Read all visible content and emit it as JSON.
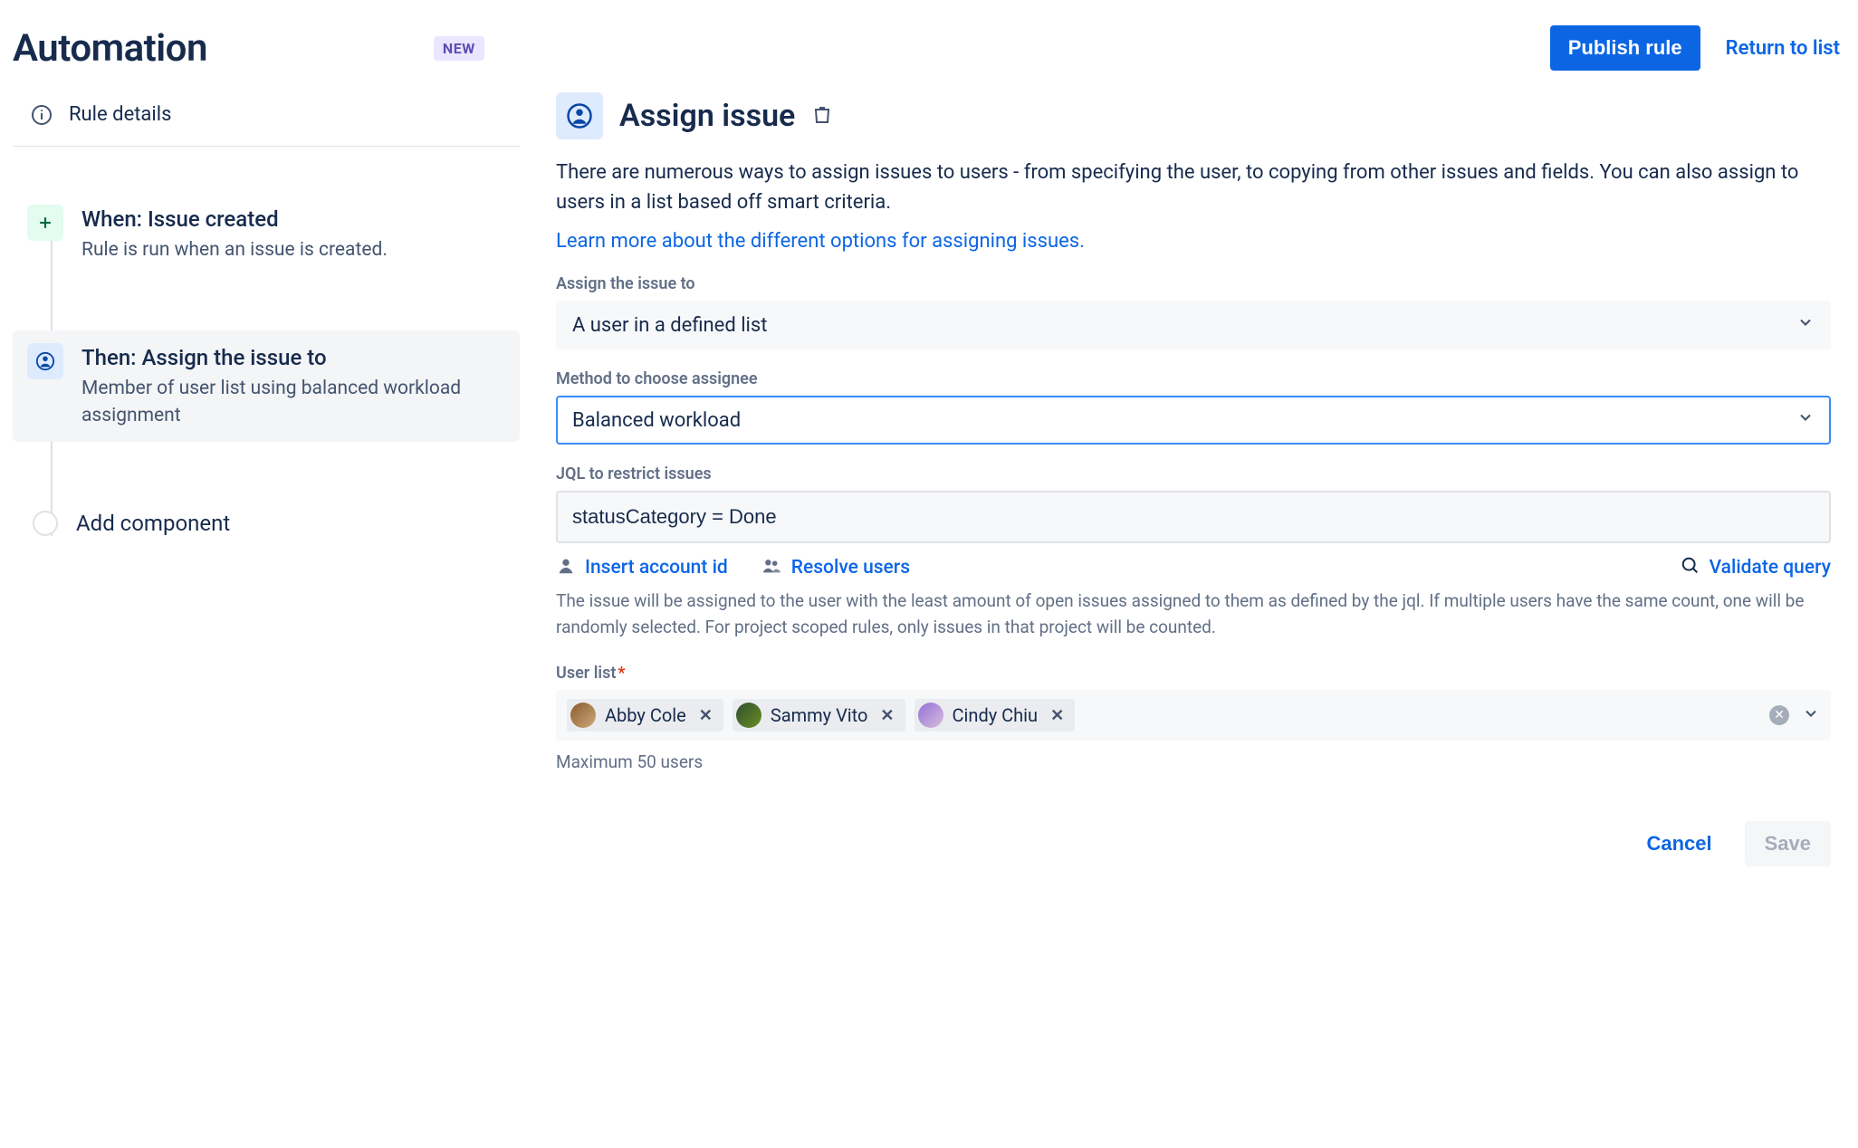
{
  "header": {
    "title": "Automation",
    "badge": "NEW",
    "publish": "Publish rule",
    "return": "Return to list"
  },
  "sidebar": {
    "rule_details": "Rule details",
    "steps": [
      {
        "title": "When: Issue created",
        "subtitle": "Rule is run when an issue is created."
      },
      {
        "title": "Then: Assign the issue to",
        "subtitle": "Member of user list using balanced workload assignment"
      }
    ],
    "add_component": "Add component"
  },
  "main": {
    "title": "Assign issue",
    "description": "There are numerous ways to assign issues to users - from specifying the user, to copying from other issues and fields. You can also assign to users in a list based off smart criteria.",
    "learn_link": "Learn more about the different options for assigning issues.",
    "fields": {
      "assign_to": {
        "label": "Assign the issue to",
        "value": "A user in a defined list"
      },
      "method": {
        "label": "Method to choose assignee",
        "value": "Balanced workload"
      },
      "jql": {
        "label": "JQL to restrict issues",
        "value": "statusCategory = Done",
        "insert_account": "Insert account id",
        "resolve_users": "Resolve users",
        "validate_query": "Validate query",
        "help": "The issue will be assigned to the user with the least amount of open issues assigned to them as defined by the jql. If multiple users have the same count, one will be randomly selected. For project scoped rules, only issues in that project will be counted."
      },
      "user_list": {
        "label": "User list",
        "required": "*",
        "users": [
          {
            "name": "Abby Cole",
            "color": "#B5651D"
          },
          {
            "name": "Sammy Vito",
            "color": "#3A5F0B"
          },
          {
            "name": "Cindy Chiu",
            "color": "#6A5ACD"
          }
        ],
        "hint": "Maximum 50 users"
      }
    },
    "actions": {
      "cancel": "Cancel",
      "save": "Save"
    }
  }
}
